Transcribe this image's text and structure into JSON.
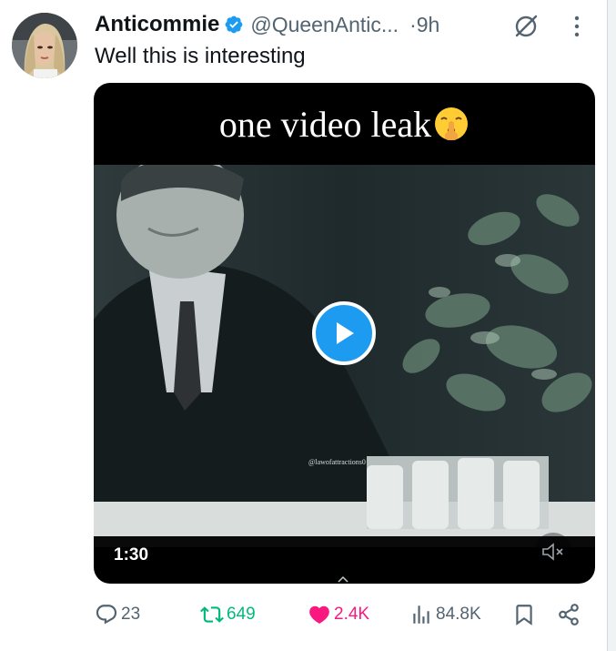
{
  "tweet": {
    "display_name": "Anticommie",
    "handle": "@QueenAntic...",
    "separator": "·",
    "time": "9h",
    "text": "Well this is interesting",
    "icons": {
      "verified": "verified-badge-icon",
      "grok": "grok-icon",
      "more": "more-options-icon"
    }
  },
  "media": {
    "overlay_title": "one video leak",
    "overlay_emoji": "shushing-face-emoji",
    "watermark": "@lawofattractions0",
    "duration": "1:30",
    "icons": {
      "play": "play-icon",
      "mute": "muted-speaker-icon"
    }
  },
  "actions": {
    "reply_count": "23",
    "repost_count": "649",
    "like_count": "2.4K",
    "view_count": "84.8K",
    "icons": {
      "reply": "reply-icon",
      "repost": "repost-icon",
      "like": "heart-icon",
      "views": "analytics-icon",
      "bookmark": "bookmark-icon",
      "share": "share-icon"
    }
  },
  "colors": {
    "accent": "#1d9bf0",
    "repost_active": "#00ba7c",
    "like_active": "#f91880",
    "secondary_text": "#536471"
  }
}
